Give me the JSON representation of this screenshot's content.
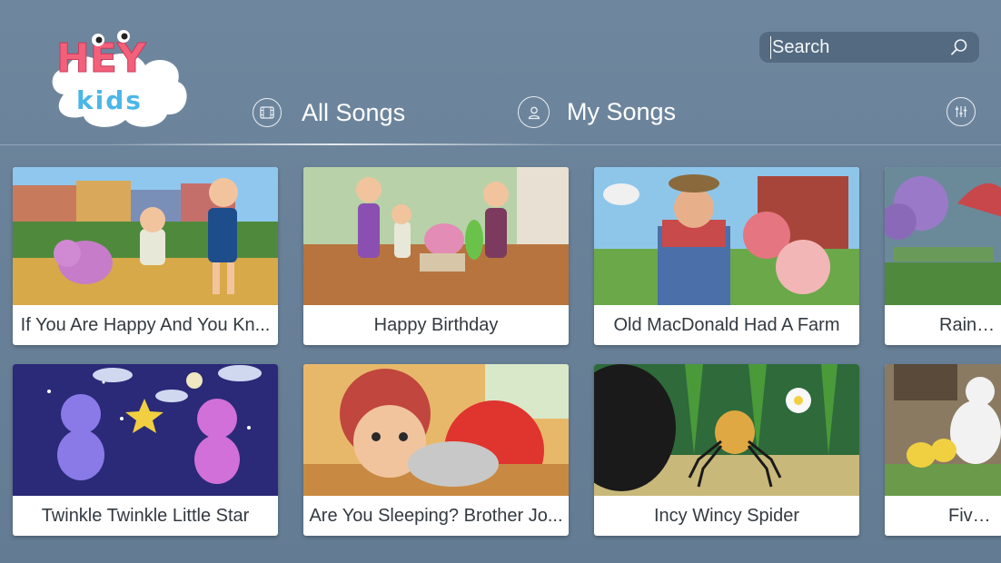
{
  "app": {
    "logo_top": "HEY",
    "logo_bottom": "kids"
  },
  "search": {
    "placeholder": "Search",
    "icon": "search-icon"
  },
  "nav": {
    "tabs": [
      {
        "label": "All Songs",
        "icon": "film-icon",
        "active": true
      },
      {
        "label": "My Songs",
        "icon": "user-icon",
        "active": false
      }
    ],
    "settings_icon": "sliders-icon"
  },
  "songs": {
    "row1": [
      {
        "title": "If You Are Happy And You Kn..."
      },
      {
        "title": "Happy Birthday"
      },
      {
        "title": "Old MacDonald Had A Farm"
      },
      {
        "title": "Rain Ra"
      }
    ],
    "row2": [
      {
        "title": "Twinkle Twinkle Little Star"
      },
      {
        "title": "Are You Sleeping? Brother Jo..."
      },
      {
        "title": "Incy Wincy Spider"
      },
      {
        "title": "Five Li"
      }
    ]
  },
  "colors": {
    "background": "#6a8299",
    "search_bg": "#536a80",
    "card_text": "#333a40"
  }
}
